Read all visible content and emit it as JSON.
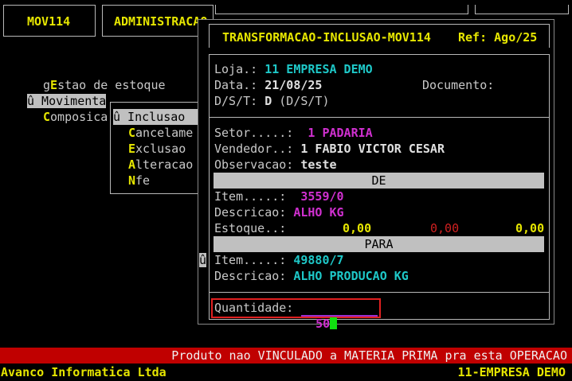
{
  "top": {
    "module_tab": "MOV114",
    "admin_tab": "ADMINISTRACAO"
  },
  "menu": {
    "items": [
      {
        "prefix": "g",
        "hot": "E",
        "rest": "stao de estoque"
      },
      {
        "prefix": "",
        "hot": "",
        "rest": "û Movimenta"
      },
      {
        "prefix": "",
        "hot": "C",
        "rest": "omposica"
      }
    ]
  },
  "submenu": {
    "items": [
      {
        "hot": "",
        "rest": "û Inclusao"
      },
      {
        "hot": "C",
        "rest": "ancelame"
      },
      {
        "hot": "E",
        "rest": "xclusao"
      },
      {
        "hot": "A",
        "rest": "lteracao"
      },
      {
        "hot": "N",
        "rest": "fe"
      }
    ]
  },
  "dialog": {
    "title": "TRANSFORMACAO-INCLUSAO-MOV114",
    "ref_label": "Ref:",
    "ref_value": "Ago/25",
    "loja_label": "Loja.:",
    "loja_value": "11 EMPRESA DEMO",
    "data_label": "Data.:",
    "data_value": "21/08/25",
    "documento_label": "Documento:",
    "dst_label": "D/S/T:",
    "dst_value": "D",
    "dst_hint": "(D/S/T)",
    "setor_label": "Setor.....:",
    "setor_value": "1 PADARIA",
    "vendedor_label": "Vendedor..:",
    "vendedor_value": "1 FABIO VICTOR CESAR",
    "obs_label": "Observacao:",
    "obs_value": "teste",
    "de_header": "DE",
    "de_item_label": "Item.....:",
    "de_item_value": "3559/0",
    "de_desc_label": "Descricao:",
    "de_desc_value": "ALHO KG",
    "estoque_label": "Estoque..:",
    "estoque_1": "0,00",
    "estoque_2": "0,00",
    "estoque_3": "0,00",
    "para_header": "PARA",
    "para_marker": "û",
    "para_item_label": "Item.....:",
    "para_item_value": "49880/7",
    "para_desc_label": "Descricao:",
    "para_desc_value": "ALHO PRODUCAO KG",
    "qtd_label": "Quantidade:",
    "qtd_value": "50"
  },
  "status": {
    "message": "Produto nao VINCULADO a MATERIA PRIMA pra esta OPERACAO",
    "company_left": "Avanco Informatica Ltda",
    "company_right": "11-EMPRESA DEMO"
  },
  "colors": {
    "yellow": "#e6e600",
    "cyan": "#1ec8c8",
    "magenta": "#d030d0",
    "status_bar": "#c00000",
    "highlight_border": "#e02020"
  }
}
